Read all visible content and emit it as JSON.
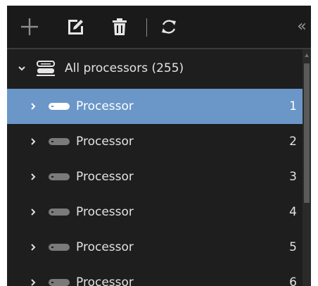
{
  "toolbar": {
    "icons": [
      "plus-icon",
      "edit-icon",
      "trash-icon",
      "refresh-icon",
      "collapse-double-chevron-icon"
    ],
    "collapse_glyph": "«"
  },
  "tree": {
    "root": {
      "label": "All processors (255)",
      "icon": "server-icon",
      "expanded": true
    },
    "items": [
      {
        "label": "Processor",
        "number": "1",
        "selected": true
      },
      {
        "label": "Processor",
        "number": "2"
      },
      {
        "label": "Processor",
        "number": "3"
      },
      {
        "label": "Processor",
        "number": "4"
      },
      {
        "label": "Processor",
        "number": "5"
      },
      {
        "label": "Processor",
        "number": "6"
      }
    ]
  },
  "colors": {
    "background": "#1e1e1e",
    "toolbar": "#1a1a1a",
    "selection": "#6a96c8",
    "text": "#e2e2e2",
    "icon": "#e6e6e6"
  }
}
